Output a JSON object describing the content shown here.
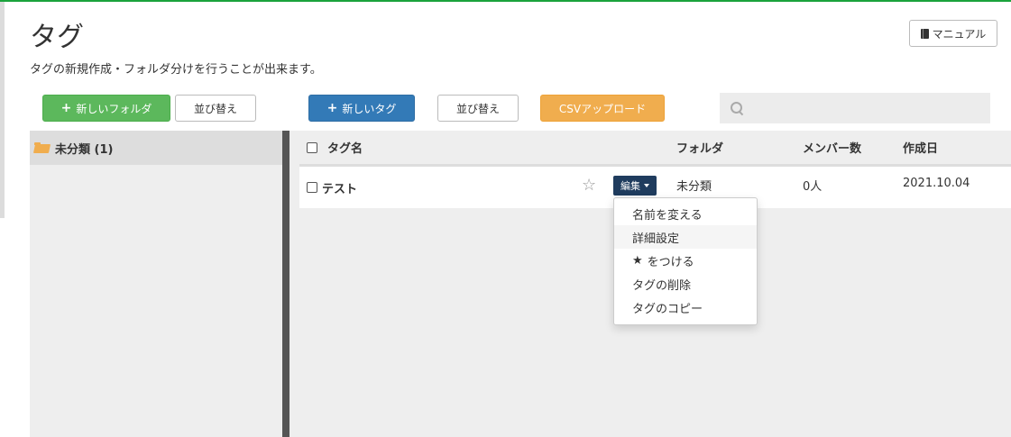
{
  "page": {
    "title": "タグ",
    "subtitle": "タグの新規作成・フォルダ分けを行うことが出来ます。",
    "manual_label": "マニュアル"
  },
  "toolbar": {
    "new_folder_label": "新しいフォルダ",
    "sort_folder_label": "並び替え",
    "new_tag_label": "新しいタグ",
    "sort_tag_label": "並び替え",
    "csv_upload_label": "CSVアップロード",
    "search_placeholder": ""
  },
  "folders": {
    "items": [
      {
        "label": "未分類 (1)"
      }
    ]
  },
  "table": {
    "headers": {
      "name": "タグ名",
      "folder": "フォルダ",
      "members": "メンバー数",
      "created": "作成日"
    },
    "rows": [
      {
        "name": "テスト",
        "edit_label": "編集",
        "folder": "未分類",
        "members": "0人",
        "created": "2021.10.04"
      }
    ]
  },
  "dropdown": {
    "items": [
      {
        "label": "名前を変える"
      },
      {
        "label": "詳細設定"
      },
      {
        "label": "をつける"
      },
      {
        "label": "タグの削除"
      },
      {
        "label": "タグのコピー"
      }
    ]
  },
  "colors": {
    "accent_green": "#5cb85c",
    "accent_blue": "#337ab7",
    "accent_orange": "#f0ad4e",
    "edit_button": "#1f3c5e"
  }
}
